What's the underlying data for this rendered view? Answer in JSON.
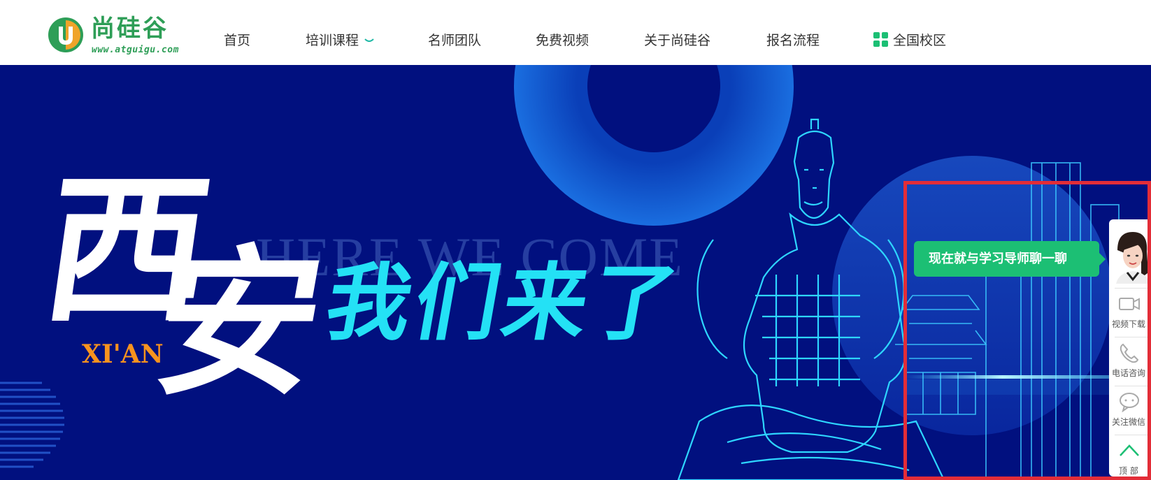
{
  "header": {
    "logo": {
      "title": "尚硅谷",
      "url": "www.atguigu.com",
      "mark_letter": "U"
    },
    "nav": [
      {
        "label": "首页"
      },
      {
        "label": "培训课程"
      },
      {
        "label": "名师团队"
      },
      {
        "label": "免费视频"
      },
      {
        "label": "关于尚硅谷"
      },
      {
        "label": "报名流程"
      },
      {
        "label": "全国校区"
      }
    ]
  },
  "banner": {
    "calligraphy_1": "西",
    "calligraphy_2": "安",
    "city_en": "XI'AN",
    "tagline_en": "HERE WE COME",
    "slogan": "我们来了"
  },
  "chat": {
    "label": "现在就与学习导师聊一聊"
  },
  "sidebar": {
    "items": [
      {
        "label": "视频下载",
        "icon": "video-camera-icon"
      },
      {
        "label": "电话咨询",
        "icon": "phone-icon"
      },
      {
        "label": "关注微信",
        "icon": "chat-bubble-icon"
      },
      {
        "label": "顶 部",
        "icon": "chevron-up-icon"
      }
    ]
  },
  "colors": {
    "brand_green": "#2e9e57",
    "brand_orange": "#f0a42a",
    "banner_bg": "#01107f",
    "slogan_cyan": "#24e1f5",
    "chat_green": "#1cbf74",
    "highlight_red": "#e32d38",
    "nav_accent": "#1fb9a6"
  }
}
